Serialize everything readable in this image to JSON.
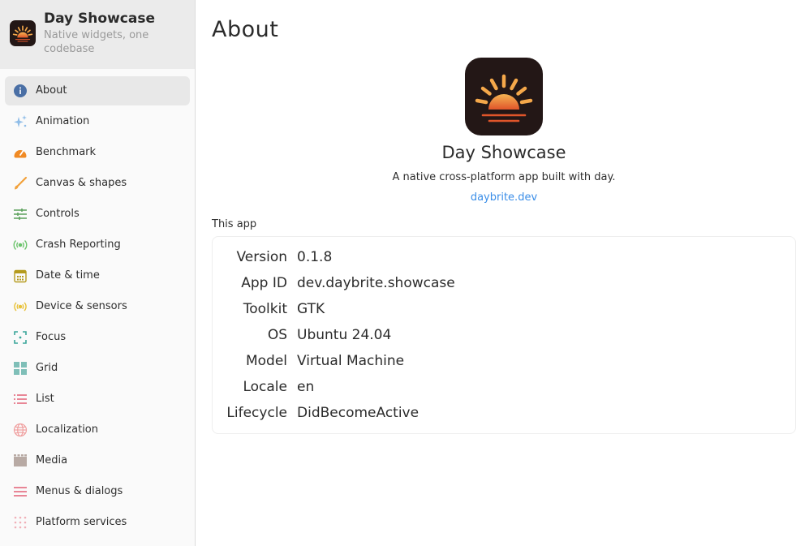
{
  "sidebar": {
    "title": "Day Showcase",
    "subtitle": "Native widgets, one codebase",
    "items": [
      {
        "label": "About",
        "icon": "info-icon",
        "color": "#4a6fa5",
        "active": true
      },
      {
        "label": "Animation",
        "icon": "sparkles-icon",
        "color": "#8fbde8"
      },
      {
        "label": "Benchmark",
        "icon": "speedometer-icon",
        "color": "#f08a24"
      },
      {
        "label": "Canvas & shapes",
        "icon": "brush-icon",
        "color": "#f2a13b"
      },
      {
        "label": "Controls",
        "icon": "sliders-icon",
        "color": "#5aa05a"
      },
      {
        "label": "Crash Reporting",
        "icon": "broadcast-icon",
        "color": "#6cc46c"
      },
      {
        "label": "Date & time",
        "icon": "calendar-icon",
        "color": "#b59b1e"
      },
      {
        "label": "Device & sensors",
        "icon": "sensor-icon",
        "color": "#e8c23a"
      },
      {
        "label": "Focus",
        "icon": "focus-icon",
        "color": "#3aa69a"
      },
      {
        "label": "Grid",
        "icon": "grid-icon",
        "color": "#7fbfb8"
      },
      {
        "label": "List",
        "icon": "list-icon",
        "color": "#e0556b"
      },
      {
        "label": "Localization",
        "icon": "globe-icon",
        "color": "#f0a0a0"
      },
      {
        "label": "Media",
        "icon": "film-icon",
        "color": "#b8aaa4"
      },
      {
        "label": "Menus & dialogs",
        "icon": "menu-icon",
        "color": "#e0556b"
      },
      {
        "label": "Platform services",
        "icon": "dots-grid-icon",
        "color": "#f0b0b8"
      }
    ]
  },
  "main": {
    "title": "About",
    "app_name": "Day Showcase",
    "description": "A native cross-platform app built with day.",
    "link": "daybrite.dev",
    "section_label": "This app",
    "info": [
      {
        "key": "Version",
        "value": "0.1.8"
      },
      {
        "key": "App ID",
        "value": "dev.daybrite.showcase"
      },
      {
        "key": "Toolkit",
        "value": "GTK"
      },
      {
        "key": "OS",
        "value": "Ubuntu 24.04"
      },
      {
        "key": "Model",
        "value": "Virtual Machine"
      },
      {
        "key": "Locale",
        "value": "en"
      },
      {
        "key": "Lifecycle",
        "value": "DidBecomeActive"
      }
    ]
  },
  "colors": {
    "logo_bg": "#231716",
    "sun_top": "#f5b452",
    "sun_bottom": "#e0552a",
    "link": "#3b8ee8",
    "active_nav": "#e8e8e8"
  }
}
